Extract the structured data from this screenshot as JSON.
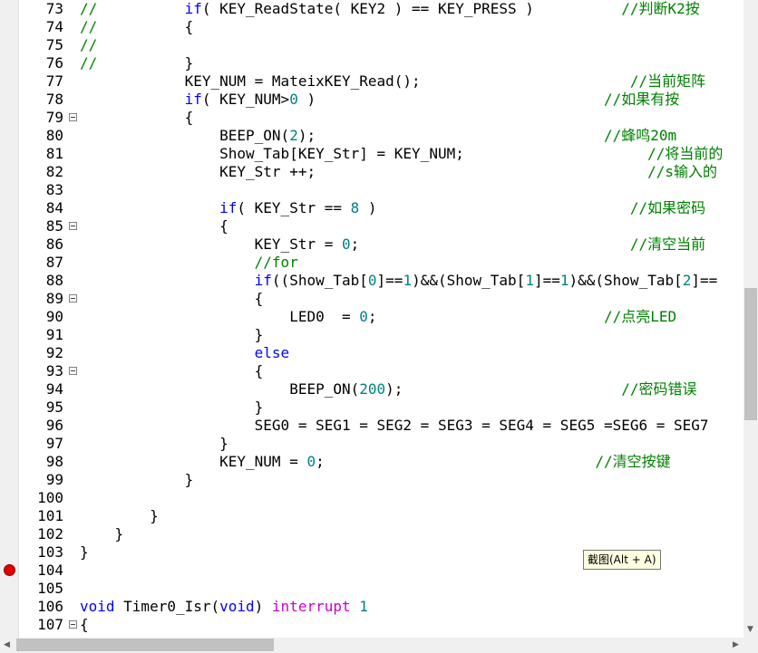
{
  "editor": {
    "lines": [
      {
        "n": "73",
        "fold": false,
        "segs": [
          [
            "cm",
            "//"
          ],
          [
            "",
            "          "
          ],
          [
            "kw",
            "if"
          ],
          [
            "",
            "( KEY_ReadState( KEY2 ) == KEY_PRESS )"
          ],
          [
            "",
            "          "
          ],
          [
            "cm",
            "//判断K2按"
          ]
        ]
      },
      {
        "n": "74",
        "fold": false,
        "segs": [
          [
            "cm",
            "//"
          ],
          [
            "",
            "          {"
          ]
        ]
      },
      {
        "n": "75",
        "fold": false,
        "segs": [
          [
            "cm",
            "//"
          ]
        ]
      },
      {
        "n": "76",
        "fold": false,
        "segs": [
          [
            "cm",
            "//"
          ],
          [
            "",
            "          }"
          ]
        ]
      },
      {
        "n": "77",
        "fold": false,
        "segs": [
          [
            "",
            "            KEY_NUM = MateixKEY_Read();"
          ],
          [
            "",
            "                        "
          ],
          [
            "cm",
            "//当前矩阵"
          ]
        ]
      },
      {
        "n": "78",
        "fold": false,
        "segs": [
          [
            "",
            "            "
          ],
          [
            "kw",
            "if"
          ],
          [
            "",
            "( KEY_NUM>"
          ],
          [
            "num",
            "0"
          ],
          [
            "",
            " )"
          ],
          [
            "",
            "                                 "
          ],
          [
            "cm",
            "//如果有按"
          ]
        ]
      },
      {
        "n": "79",
        "fold": true,
        "segs": [
          [
            "",
            "            {"
          ]
        ]
      },
      {
        "n": "80",
        "fold": false,
        "segs": [
          [
            "",
            "                BEEP_ON("
          ],
          [
            "num",
            "2"
          ],
          [
            "",
            ");"
          ],
          [
            "",
            "                                 "
          ],
          [
            "cm",
            "//蜂鸣20m"
          ]
        ]
      },
      {
        "n": "81",
        "fold": false,
        "segs": [
          [
            "",
            "                Show_Tab[KEY_Str] = KEY_NUM;"
          ],
          [
            "",
            "                     "
          ],
          [
            "cm",
            "//将当前的"
          ]
        ]
      },
      {
        "n": "82",
        "fold": false,
        "segs": [
          [
            "",
            "                KEY_Str ++;"
          ],
          [
            "",
            "                                      "
          ],
          [
            "cm",
            "//s输入的"
          ]
        ]
      },
      {
        "n": "83",
        "fold": false,
        "segs": []
      },
      {
        "n": "84",
        "fold": false,
        "segs": [
          [
            "",
            "                "
          ],
          [
            "kw",
            "if"
          ],
          [
            "",
            "( KEY_Str == "
          ],
          [
            "num",
            "8"
          ],
          [
            "",
            " )"
          ],
          [
            "",
            "                             "
          ],
          [
            "cm",
            "//如果密码"
          ]
        ]
      },
      {
        "n": "85",
        "fold": true,
        "segs": [
          [
            "",
            "                {"
          ]
        ]
      },
      {
        "n": "86",
        "fold": false,
        "segs": [
          [
            "",
            "                    KEY_Str = "
          ],
          [
            "num",
            "0"
          ],
          [
            "",
            ";"
          ],
          [
            "",
            "                               "
          ],
          [
            "cm",
            "//清空当前"
          ]
        ]
      },
      {
        "n": "87",
        "fold": false,
        "segs": [
          [
            "",
            "                    "
          ],
          [
            "cm",
            "//for"
          ]
        ]
      },
      {
        "n": "88",
        "fold": false,
        "segs": [
          [
            "",
            "                    "
          ],
          [
            "kw",
            "if"
          ],
          [
            "",
            "((Show_Tab["
          ],
          [
            "num",
            "0"
          ],
          [
            "",
            "]=="
          ],
          [
            "num",
            "1"
          ],
          [
            "",
            ")&&(Show_Tab["
          ],
          [
            "num",
            "1"
          ],
          [
            "",
            "]=="
          ],
          [
            "num",
            "1"
          ],
          [
            "",
            ")&&(Show_Tab["
          ],
          [
            "num",
            "2"
          ],
          [
            "",
            "]=="
          ]
        ]
      },
      {
        "n": "89",
        "fold": true,
        "segs": [
          [
            "",
            "                    {"
          ]
        ]
      },
      {
        "n": "90",
        "fold": false,
        "segs": [
          [
            "",
            "                        LED0  = "
          ],
          [
            "num",
            "0"
          ],
          [
            "",
            ";"
          ],
          [
            "",
            "                          "
          ],
          [
            "cm",
            "//点亮LED"
          ]
        ]
      },
      {
        "n": "91",
        "fold": false,
        "segs": [
          [
            "",
            "                    }"
          ]
        ]
      },
      {
        "n": "92",
        "fold": false,
        "segs": [
          [
            "",
            "                    "
          ],
          [
            "kw",
            "else"
          ]
        ]
      },
      {
        "n": "93",
        "fold": true,
        "segs": [
          [
            "",
            "                    {"
          ]
        ]
      },
      {
        "n": "94",
        "fold": false,
        "segs": [
          [
            "",
            "                        BEEP_ON("
          ],
          [
            "num",
            "200"
          ],
          [
            "",
            ");"
          ],
          [
            "",
            "                         "
          ],
          [
            "cm",
            "//密码错误"
          ]
        ]
      },
      {
        "n": "95",
        "fold": false,
        "segs": [
          [
            "",
            "                    }"
          ]
        ]
      },
      {
        "n": "96",
        "fold": false,
        "segs": [
          [
            "",
            "                    SEG0 = SEG1 = SEG2 = SEG3 = SEG4 = SEG5 =SEG6 = SEG7"
          ]
        ]
      },
      {
        "n": "97",
        "fold": false,
        "segs": [
          [
            "",
            "                }"
          ]
        ]
      },
      {
        "n": "98",
        "fold": false,
        "segs": [
          [
            "",
            "                KEY_NUM = "
          ],
          [
            "num",
            "0"
          ],
          [
            "",
            ";"
          ],
          [
            "",
            "                               "
          ],
          [
            "cm",
            "//清空按键"
          ]
        ]
      },
      {
        "n": "99",
        "fold": false,
        "segs": [
          [
            "",
            "            }"
          ]
        ]
      },
      {
        "n": "100",
        "fold": false,
        "segs": []
      },
      {
        "n": "101",
        "fold": false,
        "segs": [
          [
            "",
            "        }"
          ]
        ]
      },
      {
        "n": "102",
        "fold": false,
        "segs": [
          [
            "",
            "    }"
          ]
        ]
      },
      {
        "n": "103",
        "fold": false,
        "segs": [
          [
            "",
            "}"
          ]
        ]
      },
      {
        "n": "104",
        "fold": false,
        "breakpoint": true,
        "segs": []
      },
      {
        "n": "105",
        "fold": false,
        "segs": []
      },
      {
        "n": "106",
        "fold": false,
        "segs": [
          [
            "kw",
            "void"
          ],
          [
            "",
            " Timer0_Isr("
          ],
          [
            "kw",
            "void"
          ],
          [
            "",
            ") "
          ],
          [
            "ks",
            "interrupt"
          ],
          [
            "",
            " "
          ],
          [
            "num",
            "1"
          ]
        ]
      },
      {
        "n": "107",
        "fold": true,
        "segs": [
          [
            "",
            "{"
          ]
        ]
      }
    ]
  },
  "tooltip": {
    "text": "截图(Alt + A)"
  },
  "colors": {
    "keyword": "#0000ff",
    "comment": "#008000",
    "number": "#008080",
    "interrupt": "#cc00cc",
    "breakpoint": "#e00000"
  }
}
